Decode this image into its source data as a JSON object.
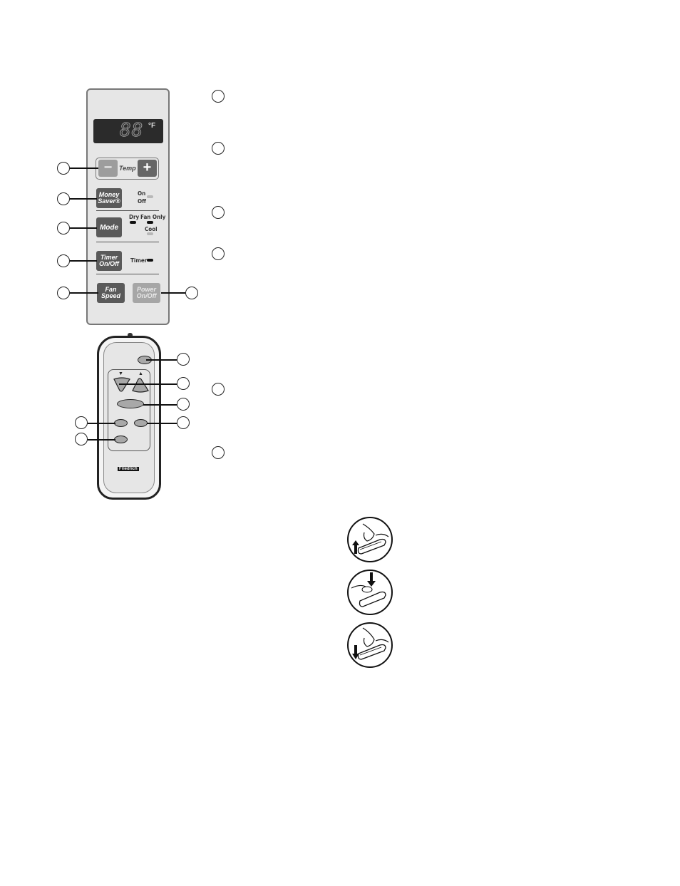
{
  "control_panel": {
    "display": {
      "digits": "88",
      "unit": "°F"
    },
    "temp": {
      "minus_label": "−",
      "plus_label": "+",
      "label": "Temp"
    },
    "money_saver": {
      "line1": "Money",
      "line2": "Saver®",
      "indicator_on": "On",
      "indicator_off": "Off"
    },
    "mode": {
      "label": "Mode",
      "indicator_dry": "Dry",
      "indicator_fan_only": "Fan Only",
      "indicator_cool": "Cool"
    },
    "timer": {
      "line1": "Timer",
      "line2": "On/Off",
      "indicator": "Timer"
    },
    "fan_speed": {
      "line1": "Fan",
      "line2": "Speed"
    },
    "power": {
      "line1": "Power",
      "line2": "On/Off"
    }
  },
  "remote": {
    "down_arrow": "▼",
    "up_arrow": "▲",
    "brand_logo": "Friedrich"
  },
  "callouts": {
    "panel_left": [
      "",
      "",
      "",
      "",
      ""
    ],
    "panel_right": [
      ""
    ],
    "remote_right": [
      "",
      "",
      "",
      ""
    ],
    "remote_left": [
      "",
      ""
    ],
    "description_column": [
      "",
      "",
      "",
      "",
      "",
      ""
    ]
  },
  "battery_steps": [
    {
      "name": "open-battery-cover",
      "arrow": "up"
    },
    {
      "name": "insert-batteries",
      "arrow": "down"
    },
    {
      "name": "close-battery-cover",
      "arrow": "down"
    }
  ]
}
